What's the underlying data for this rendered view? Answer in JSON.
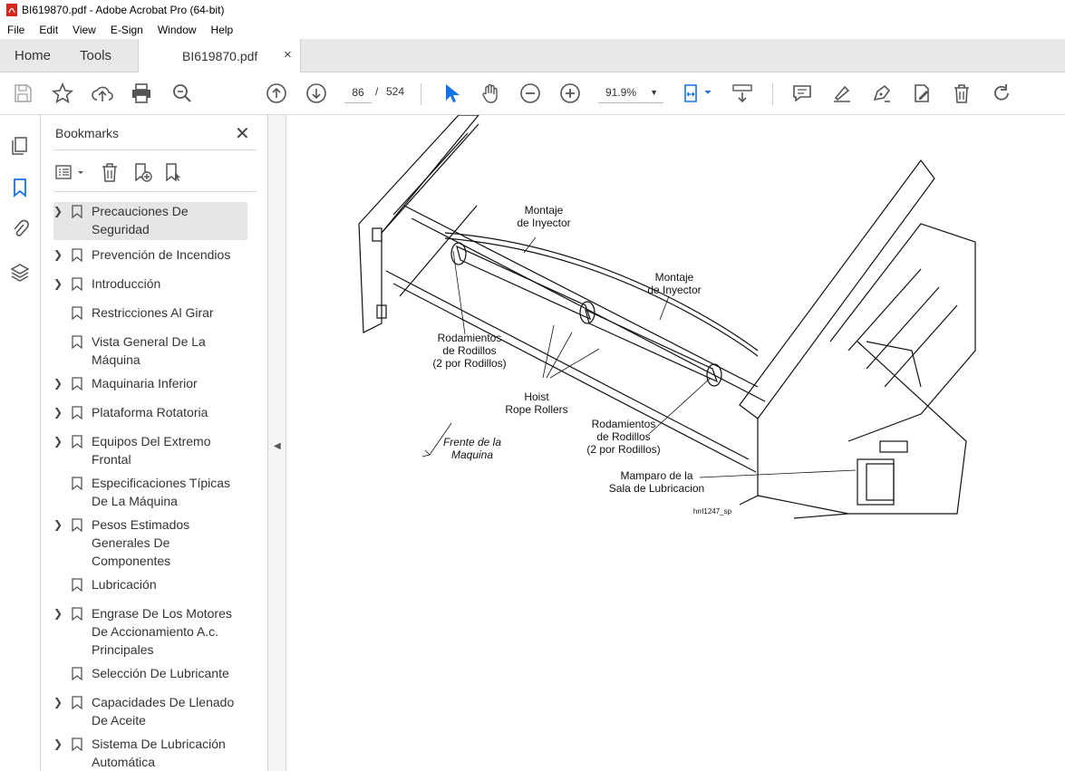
{
  "window": {
    "title": "BI619870.pdf - Adobe Acrobat Pro (64-bit)"
  },
  "menu": [
    "File",
    "Edit",
    "View",
    "E-Sign",
    "Window",
    "Help"
  ],
  "tabs": {
    "home": "Home",
    "tools": "Tools",
    "document": "BI619870.pdf",
    "close": "×"
  },
  "toolbar": {
    "page_current": "86",
    "page_sep": "/",
    "page_total": "524",
    "zoom": "91.9%",
    "zoom_caret": "▼"
  },
  "bookmarks": {
    "title": "Bookmarks",
    "close": "✕",
    "items": [
      {
        "label": "Precauciones De Seguridad",
        "expandable": true,
        "selected": true
      },
      {
        "label": "Prevención de Incendios",
        "expandable": true
      },
      {
        "label": "Introducción",
        "expandable": true
      },
      {
        "label": "Restricciones Al Girar",
        "expandable": false
      },
      {
        "label": "Vista General De La Máquina",
        "expandable": false
      },
      {
        "label": "Maquinaria Inferior",
        "expandable": true
      },
      {
        "label": "Plataforma Rotatoria",
        "expandable": true
      },
      {
        "label": "Equipos Del Extremo Frontal",
        "expandable": true
      },
      {
        "label": "Especificaciones Típicas De La Máquina",
        "expandable": false
      },
      {
        "label": "Pesos Estimados Generales De Componentes",
        "expandable": true
      },
      {
        "label": "Lubricación",
        "expandable": false
      },
      {
        "label": "Engrase De Los Motores De Accionamiento A.c. Principales",
        "expandable": true
      },
      {
        "label": "Selección De Lubricante",
        "expandable": false
      },
      {
        "label": "Capacidades De Llenado De Aceite",
        "expandable": true
      },
      {
        "label": "Sistema De Lubricación Automática",
        "expandable": true
      }
    ]
  },
  "figure": {
    "labels": {
      "montaje1": "Montaje\nde Inyector",
      "montaje2": "Montaje\nde Inyector",
      "rodamientos1": "Rodamientos\nde Rodillos\n(2 por Rodillos)",
      "rodamientos2": "Rodamientos\nde Rodillos\n(2 por Rodillos)",
      "hoist": "Hoist\nRope Rollers",
      "frente": "Frente de la\nMaquina",
      "mamparo": "Mamparo de la\nSala de Lubricacion",
      "code": "hrrl1247_sp"
    }
  },
  "colors": {
    "accent": "#1473e6",
    "tab_bg": "#e8e8e8",
    "selected_bg": "#e6e6e6"
  }
}
